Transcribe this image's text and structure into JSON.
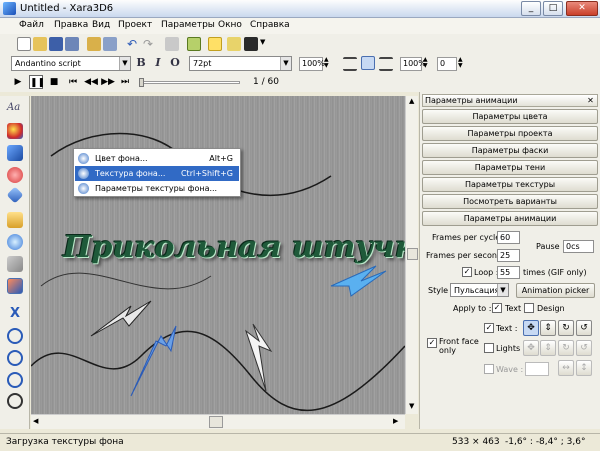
{
  "window": {
    "title": "Untitled - Xara3D6"
  },
  "menu": [
    "Файл",
    "Правка",
    "Вид",
    "Проект",
    "Параметры",
    "Окно",
    "Справка"
  ],
  "format_bar": {
    "font": "Andantino script",
    "size": "72pt",
    "zoom1": "100%",
    "zoom2": "100%",
    "spacing": "0",
    "bold": "B",
    "italic": "I",
    "outline": "O"
  },
  "playback": {
    "frame": "1 / 60"
  },
  "context_menu": [
    {
      "label": "Цвет фона...",
      "shortcut": "Alt+G",
      "selected": false
    },
    {
      "label": "Текстура фона...",
      "shortcut": "Ctrl+Shift+G",
      "selected": true
    },
    {
      "label": "Параметры текстуры фона...",
      "shortcut": "",
      "selected": false
    }
  ],
  "canvas_text": "Прикольная штучка",
  "panel": {
    "title": "Параметры анимации",
    "buttons": [
      "Параметры цвета",
      "Параметры проекта",
      "Параметры фаски",
      "Параметры тени",
      "Параметры текстуры",
      "Посмотреть варианты",
      "Параметры анимации"
    ],
    "frames_per_cycle_label": "Frames per cycle :",
    "frames_per_cycle": "60",
    "frames_per_second_label": "Frames per second :",
    "frames_per_second": "25",
    "pause_label": "Pause :",
    "pause_value": "0cs",
    "loop_label": "Loop :",
    "loop_value": "55",
    "loop_suffix": "times (GIF only)",
    "style_label": "Style :",
    "style_value": "Пульсация",
    "animation_picker": "Animation picker",
    "apply_to_label": "Apply to :",
    "text_label": "Text",
    "design_label": "Design",
    "front_face_label": "Front face only",
    "text_row_label": "Text :",
    "lights_label": "Lights :",
    "wave_label": "Wave :"
  },
  "status": {
    "message": "Загрузка текстуры фона",
    "size": "533 × 463",
    "angles": "-1,6° : -8,4° ; 3,6°"
  }
}
